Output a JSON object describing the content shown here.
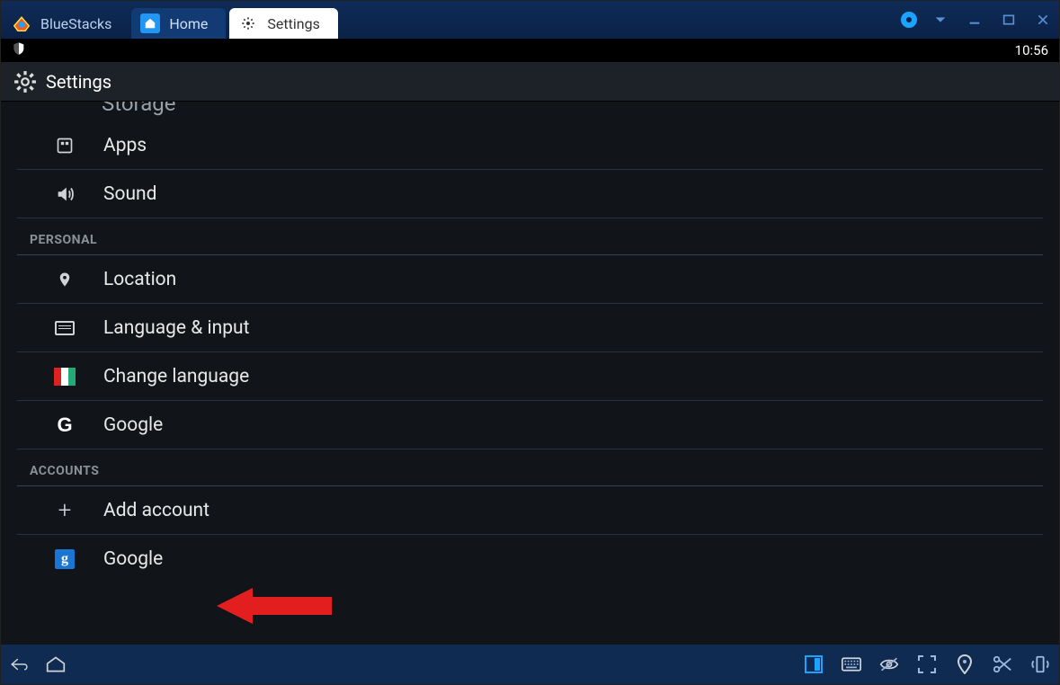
{
  "chrome": {
    "brand": "BlueStacks",
    "tabs": [
      {
        "id": "home",
        "label": "Home",
        "active": false
      },
      {
        "id": "settings",
        "label": "Settings",
        "active": true
      }
    ]
  },
  "statusbar": {
    "time": "10:56"
  },
  "settings_header": {
    "title": "Settings"
  },
  "list": {
    "cutoff_item": "Storage",
    "pre_section_items": [
      {
        "id": "apps",
        "label": "Apps",
        "icon": "apps-icon"
      },
      {
        "id": "sound",
        "label": "Sound",
        "icon": "sound-icon"
      }
    ],
    "sections": [
      {
        "title": "PERSONAL",
        "items": [
          {
            "id": "location",
            "label": "Location",
            "icon": "location-icon"
          },
          {
            "id": "lang",
            "label": "Language & input",
            "icon": "keyboard-icon"
          },
          {
            "id": "changelang",
            "label": "Change language",
            "icon": "flag-icon"
          },
          {
            "id": "google",
            "label": "Google",
            "icon": "google-g-icon"
          }
        ]
      },
      {
        "title": "ACCOUNTS",
        "items": [
          {
            "id": "addacct",
            "label": "Add account",
            "icon": "plus-icon"
          },
          {
            "id": "googleacct",
            "label": "Google",
            "icon": "google-blue-icon",
            "highlight": true
          }
        ]
      }
    ]
  },
  "annotation": {
    "arrow_points_to": "googleacct"
  }
}
